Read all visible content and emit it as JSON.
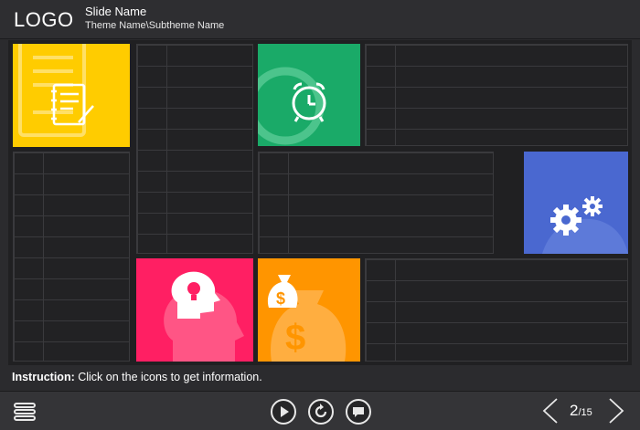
{
  "header": {
    "logo": "LOGO",
    "slide_name": "Slide Name",
    "theme_name": "Theme Name\\Subtheme Name"
  },
  "instruction": {
    "label": "Instruction:",
    "text": " Click on the icons to get information."
  },
  "tiles": [
    {
      "name": "notes",
      "color": "#ffcc00",
      "icon": "notebook-pen-icon"
    },
    {
      "name": "clock",
      "color": "#1aaa68",
      "icon": "alarm-clock-icon"
    },
    {
      "name": "settings",
      "color": "#4a68d0",
      "icon": "gears-icon"
    },
    {
      "name": "ideas",
      "color": "#ff1f63",
      "icon": "head-lightbulb-icon"
    },
    {
      "name": "money",
      "color": "#ff9500",
      "icon": "money-bag-icon"
    }
  ],
  "footer": {
    "page_current": "2",
    "page_total": "/15",
    "buttons": [
      "menu-icon",
      "play-icon",
      "replay-icon",
      "comment-icon",
      "prev-arrow-icon",
      "next-arrow-icon"
    ]
  }
}
